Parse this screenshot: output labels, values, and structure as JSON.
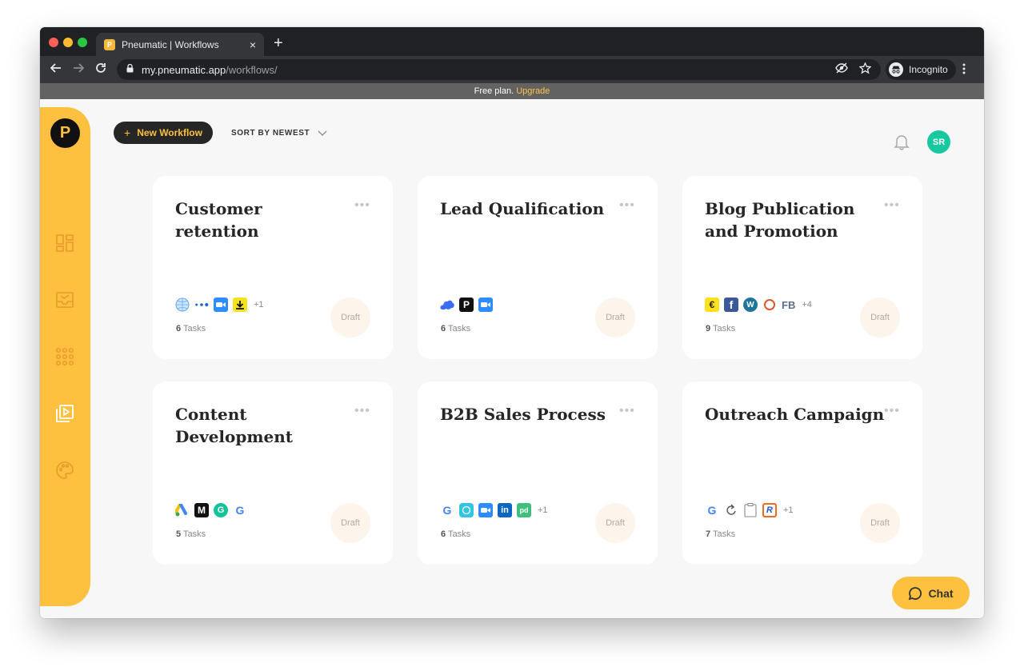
{
  "browser": {
    "tab_title": "Pneumatic | Workflows",
    "favicon_letter": "P",
    "close_glyph": "×",
    "new_tab_glyph": "+",
    "url_host": "my.pneumatic.app",
    "url_path": "/workflows/",
    "incognito_label": "Incognito"
  },
  "banner": {
    "text": "Free plan.",
    "link": "Upgrade"
  },
  "header": {
    "new_workflow_label": "New Workflow",
    "sort_label": "SORT BY NEWEST",
    "avatar_initials": "SR"
  },
  "sidebar": {
    "logo_letter": "P",
    "items": [
      {
        "icon": "dashboard-icon"
      },
      {
        "icon": "inbox-icon"
      },
      {
        "icon": "templates-grid-icon"
      },
      {
        "icon": "video-library-icon"
      },
      {
        "icon": "palette-icon"
      }
    ]
  },
  "cards": [
    {
      "title": "Customer retention",
      "tasks_count": "6",
      "tasks_label": "Tasks",
      "more": "+1",
      "status": "Draft",
      "integrations": [
        "sphere-icon",
        "dots-icon",
        "zoom-icon",
        "download-icon"
      ]
    },
    {
      "title": "Lead Qualification",
      "tasks_count": "6",
      "tasks_label": "Tasks",
      "more": "",
      "status": "Draft",
      "integrations": [
        "cloud-icon",
        "p-icon",
        "zoom-icon"
      ]
    },
    {
      "title": "Blog Publication and Promotion",
      "tasks_count": "9",
      "tasks_label": "Tasks",
      "more": "+4",
      "status": "Draft",
      "integrations": [
        "mailchimp-icon",
        "facebook-icon",
        "wordpress-icon",
        "ring-icon",
        "fb-text-icon"
      ]
    },
    {
      "title": "Content Development",
      "tasks_count": "5",
      "tasks_label": "Tasks",
      "more": "",
      "status": "Draft",
      "integrations": [
        "google-ads-icon",
        "medium-icon",
        "grammarly-icon",
        "google-icon"
      ]
    },
    {
      "title": "B2B Sales Process",
      "tasks_count": "6",
      "tasks_label": "Tasks",
      "more": "+1",
      "status": "Draft",
      "integrations": [
        "google-icon",
        "hello-icon",
        "zoom-icon",
        "linkedin-icon",
        "pd-icon"
      ]
    },
    {
      "title": "Outreach Campaign",
      "tasks_count": "7",
      "tasks_label": "Tasks",
      "more": "+1",
      "status": "Draft",
      "integrations": [
        "google-icon",
        "refresh-icon",
        "clipboard-icon",
        "r-icon"
      ]
    }
  ],
  "chat": {
    "label": "Chat"
  },
  "glyphs": {
    "fb": "FB",
    "medium": "M",
    "grammarly": "G",
    "google": "G",
    "p": "P",
    "linkedin": "in",
    "pd": "pd",
    "r": "R",
    "fb_letter": "f",
    "mailchimp": "€",
    "wordpress": "W"
  }
}
